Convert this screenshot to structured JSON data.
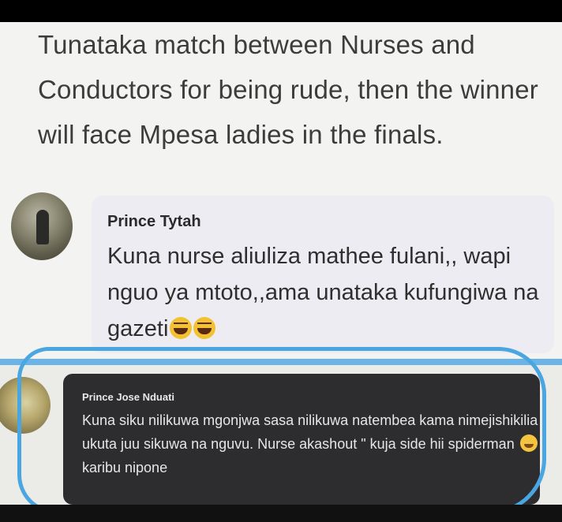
{
  "post": {
    "text": "Tunataka match between Nurses and Conductors for being rude, then the winner will face Mpesa ladies in the finals."
  },
  "comments": [
    {
      "author": "Prince Tytah",
      "text": "Kuna nurse aliuliza mathee fulani,, wapi nguo ya mtoto,,ama unataka kufungiwa na gazeti",
      "emoji": "laughing-tears"
    },
    {
      "author": "Prince Jose Nduati",
      "text_before": "Kuna siku nilikuwa mgonjwa sasa nilikuwa natembea kama nimejishikilia ukuta juu sikuwa na nguvu. Nurse akashout \" kuja side hii spiderman",
      "text_after": "karibu nipone",
      "emoji": "grinning-face"
    }
  ],
  "colors": {
    "highlight": "#4aa6e0",
    "divider": "#6ab4e8",
    "dark_comment_bg": "#2d2d2f"
  }
}
